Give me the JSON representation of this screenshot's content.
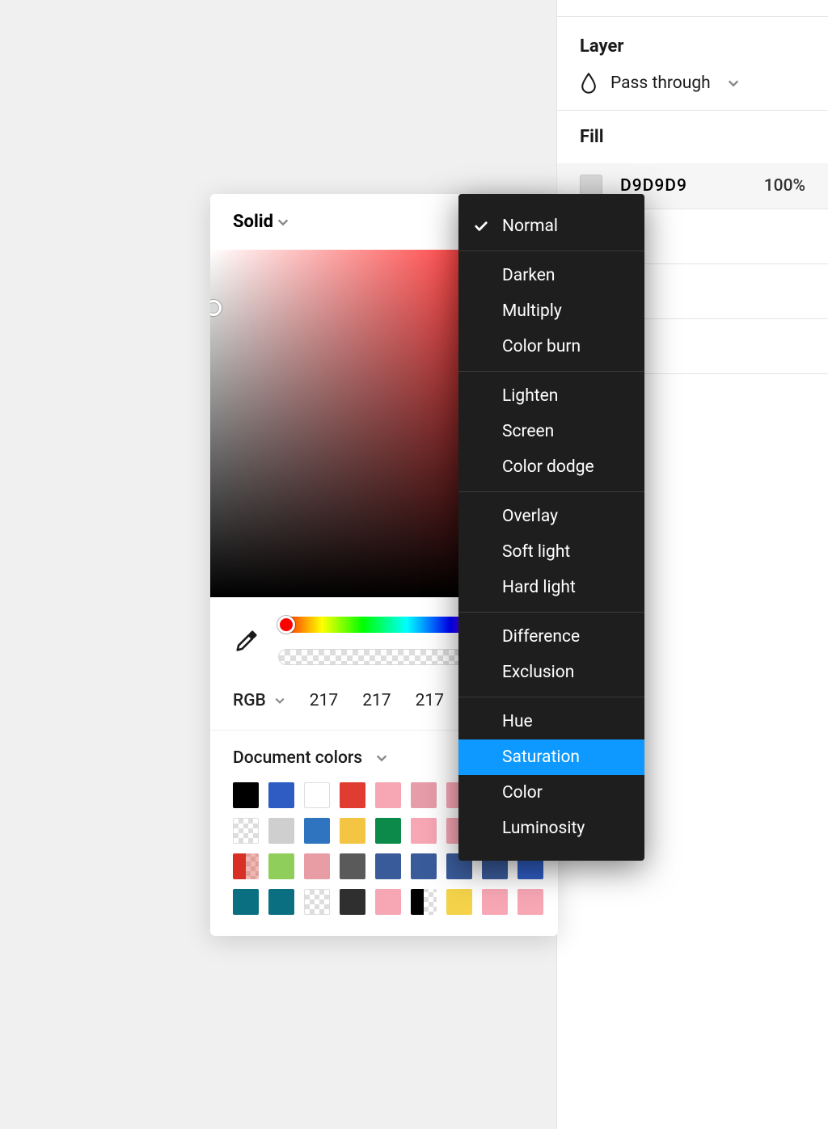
{
  "props": {
    "layer_title": "Layer",
    "blend_mode": "Pass through",
    "fill_title": "Fill",
    "fill_hex": "D9D9D9",
    "fill_opacity": "100%"
  },
  "picker": {
    "type_label": "Solid",
    "color_mode": "RGB",
    "r": "217",
    "g": "217",
    "b": "217",
    "doc_colors_label": "Document colors"
  },
  "swatches": [
    "#000000",
    "#2f5cc2",
    "#ffffff",
    "#e03c31",
    "#f7a6b4",
    "#e69ca9",
    "#f7a6b4",
    "#f7a6b4",
    "#f7a6b4",
    "checker",
    "#cfcfcf",
    "#2f74bf",
    "#f4c542",
    "#0b8a4a",
    "#f7a6b4",
    "#f7a6b4",
    "#2f5cc2",
    "#f7a6b4",
    "halfred",
    "#8fce5a",
    "#e89ca4",
    "#5a5a5a",
    "#3a5b9a",
    "#3a5b9a",
    "#3a5b9a",
    "#3a5b9a",
    "#2f5cc2",
    "#0a6f80",
    "#0a6f80",
    "checker",
    "#2f2f2f",
    "#f7a6b4",
    "halfblack",
    "#f4d34a",
    "#f7a6b4",
    "#f7a6b4"
  ],
  "dropdown": {
    "groups": [
      [
        "Normal"
      ],
      [
        "Darken",
        "Multiply",
        "Color burn"
      ],
      [
        "Lighten",
        "Screen",
        "Color dodge"
      ],
      [
        "Overlay",
        "Soft light",
        "Hard light"
      ],
      [
        "Difference",
        "Exclusion"
      ],
      [
        "Hue",
        "Saturation",
        "Color",
        "Luminosity"
      ]
    ],
    "checked": "Normal",
    "highlighted": "Saturation"
  }
}
